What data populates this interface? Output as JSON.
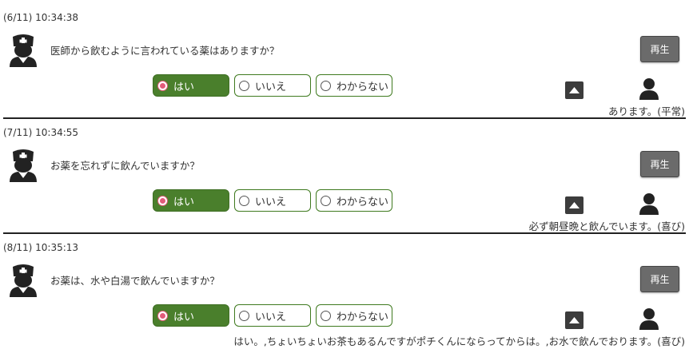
{
  "play_label": "再生",
  "entries": [
    {
      "timestamp": "(6/11) 10:34:38",
      "question": "医師から飲むように言われている薬はありますか？",
      "options": [
        "はい",
        "いいえ",
        "わからない"
      ],
      "selected": "はい",
      "answer": "あります。(平常)"
    },
    {
      "timestamp": "(7/11) 10:34:55",
      "question": "お薬を忘れずに飲んでいますか？",
      "options": [
        "はい",
        "いいえ",
        "わからない"
      ],
      "selected": "はい",
      "answer": "必ず朝昼晩と飲んでいます。(喜び)"
    },
    {
      "timestamp": "(8/11) 10:35:13",
      "question": "お薬は、水や白湯で飲んでいますか？",
      "options": [
        "はい",
        "いいえ",
        "わからない"
      ],
      "selected": "はい",
      "answer": "はい。,ちょいちょいお茶もあるんですがポチくんにならってからは。,お水で飲んでおります。(喜び)"
    }
  ],
  "icons": {
    "doctor": "doctor-icon",
    "scroll_up": "caret-up-icon",
    "user": "person-icon"
  },
  "colors": {
    "selected_option": "#4a7f2c",
    "option_border": "#3f7a1f",
    "radio_selected": "#e25b7a",
    "play_button": "#6b6b6b"
  }
}
